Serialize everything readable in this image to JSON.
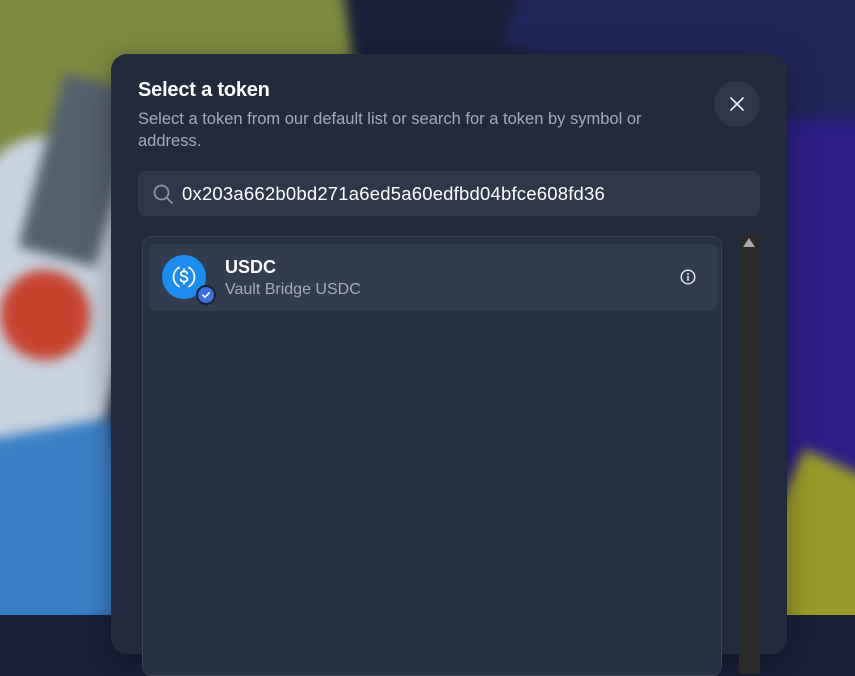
{
  "modal": {
    "title": "Select a token",
    "subtitle": "Select a token from our default list or search for a token by symbol or address.",
    "close_icon": "close-icon"
  },
  "search": {
    "icon": "search-icon",
    "value": "0x203a662b0bd271a6ed5a60edfbd04bfce608fd36"
  },
  "tokens": [
    {
      "symbol": "USDC",
      "name": "Vault Bridge USDC",
      "logo_icon": "usdc-logo-icon",
      "badge_icon": "verified-check-icon",
      "info_icon": "info-icon"
    }
  ],
  "colors": {
    "modal_bg": "#222b3c",
    "row_bg": "#323c4f",
    "usdc_blue": "#1c8cf0",
    "verified_blue": "#3b6fe0",
    "muted_text": "#a3abbb"
  }
}
